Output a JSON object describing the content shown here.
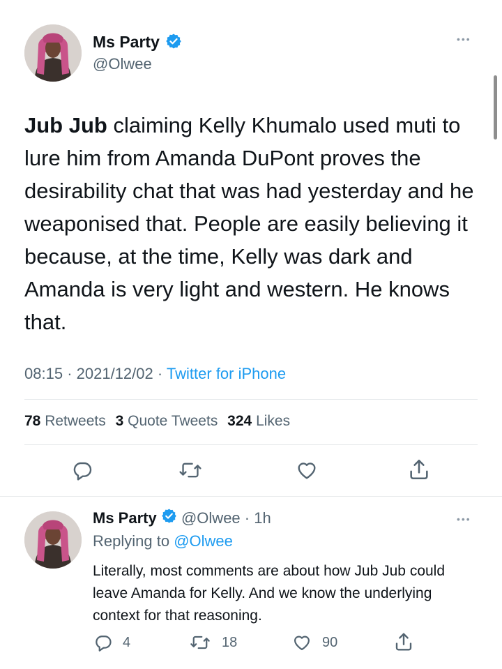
{
  "main_tweet": {
    "display_name": "Ms Party",
    "handle": "@Olwee",
    "text_bold": "Jub Jub",
    "text_rest": " claiming Kelly Khumalo used muti to lure him from Amanda DuPont proves the desirability chat that was had yesterday and he weaponised that. People are easily believing it because, at the time, Kelly was dark and Amanda is very light and western. He knows that.",
    "time": "08:15",
    "date": "2021/12/02",
    "separator": "·",
    "source": "Twitter for iPhone",
    "stats": {
      "retweets_count": "78",
      "retweets_label": "Retweets",
      "quotes_count": "3",
      "quotes_label": "Quote Tweets",
      "likes_count": "324",
      "likes_label": "Likes"
    },
    "actions": [
      "reply-icon",
      "retweet-icon",
      "like-icon",
      "share-icon"
    ]
  },
  "reply_tweet": {
    "display_name": "Ms Party",
    "handle": "@Olwee",
    "age": "· 1h",
    "replying_label": "Replying to",
    "replying_handle": "@Olwee",
    "text": "Literally, most comments are about how Jub Jub could leave Amanda for Kelly. And we know the underlying context for that reasoning.",
    "reply_count": "4",
    "retweet_count": "18",
    "like_count": "90"
  },
  "more_glyph": "•••",
  "colors": {
    "accent": "#1d9bf0",
    "text": "#0f1419",
    "muted": "#536471",
    "divider": "#e6e9eb"
  }
}
